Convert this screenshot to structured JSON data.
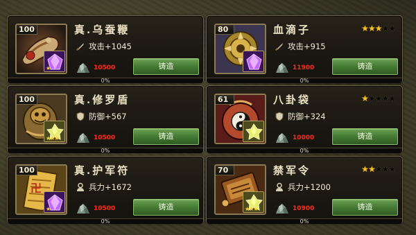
{
  "colors": {
    "button_green": "#477c35",
    "cost_red": "#ff2a1a",
    "star_gold": "#f6c22a"
  },
  "items": [
    {
      "level": "100",
      "name": "真.乌蚕鞭",
      "stars_filled": 0,
      "stars_total": 0,
      "stat_icon": "sword-icon",
      "stat": "攻击+1045",
      "cost_icon": "ore-icon",
      "cost": "10500",
      "button": "铸造",
      "gem_icon": "purple-gem-icon",
      "gem_stars": "★",
      "progress_percent": 0,
      "progress_label": "0%"
    },
    {
      "level": "80",
      "name": "血滴子",
      "stars_filled": 3,
      "stars_total": 5,
      "stat_icon": "sword-icon",
      "stat": "攻击+915",
      "cost_icon": "ore-icon",
      "cost": "11900",
      "button": "铸造",
      "gem_icon": "purple-gem-icon",
      "gem_stars": "",
      "progress_percent": 0,
      "progress_label": "0%"
    },
    {
      "level": "100",
      "name": "真.修罗盾",
      "stars_filled": 0,
      "stars_total": 0,
      "stat_icon": "shield-icon",
      "stat": "防御+567",
      "cost_icon": "ore-icon",
      "cost": "10500",
      "button": "铸造",
      "gem_icon": "yellow-gem-icon",
      "gem_stars": "★★★",
      "progress_percent": 0,
      "progress_label": "0%"
    },
    {
      "level": "61",
      "name": "八卦袋",
      "stars_filled": 1,
      "stars_total": 5,
      "stat_icon": "shield-icon",
      "stat": "防御+324",
      "cost_icon": "ore-icon",
      "cost": "10000",
      "button": "铸造",
      "gem_icon": "yellow-gem-icon",
      "gem_stars": "",
      "progress_percent": 0,
      "progress_label": "0%"
    },
    {
      "level": "100",
      "name": "真.护军符",
      "stars_filled": 0,
      "stars_total": 0,
      "stat_icon": "soldier-icon",
      "stat": "兵力+1672",
      "cost_icon": "ore-icon",
      "cost": "10500",
      "button": "铸造",
      "gem_icon": "purple-gem-icon",
      "gem_stars": "★",
      "progress_percent": 0,
      "progress_label": "0%"
    },
    {
      "level": "70",
      "name": "禁军令",
      "stars_filled": 2,
      "stars_total": 5,
      "stat_icon": "soldier-icon",
      "stat": "兵力+1200",
      "cost_icon": "ore-icon",
      "cost": "10900",
      "button": "铸造",
      "gem_icon": "yellow-gem-icon",
      "gem_stars": "★★★",
      "progress_percent": 0,
      "progress_label": "0%"
    }
  ]
}
